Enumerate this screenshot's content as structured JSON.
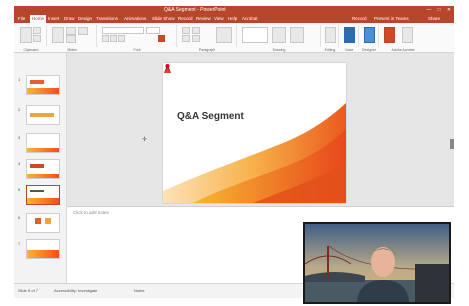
{
  "window": {
    "doc_title": "Q&A Segment - PowerPoint",
    "controls": [
      "—",
      "□",
      "✕"
    ]
  },
  "ribbon_tabs": [
    "File",
    "Home",
    "Insert",
    "Draw",
    "Design",
    "Transitions",
    "Animations",
    "Slide Show",
    "Record",
    "Review",
    "View",
    "Help",
    "Acrobat"
  ],
  "active_tab": "Home",
  "ribbon_right": [
    "Record",
    "Present in Teams",
    "Share"
  ],
  "ribbon_groups": [
    "Clipboard",
    "Slides",
    "Font",
    "Paragraph",
    "Drawing",
    "Editing",
    "Voice",
    "Designer",
    "Adobe Acrobat"
  ],
  "thumbnails": [
    "1",
    "2",
    "3",
    "4",
    "5",
    "6",
    "7"
  ],
  "selected_slide": "5",
  "slide": {
    "title": "Q&A Segment"
  },
  "notes": {
    "placeholder": "Click to add notes"
  },
  "status": {
    "slide_info": "Slide 5 of 7",
    "accessibility": "Accessibility: Investigate",
    "notes_label": "Notes"
  },
  "colors": {
    "accent": "#b7472a",
    "slide_orange": "#f28c28",
    "slide_deep": "#e8481c"
  }
}
